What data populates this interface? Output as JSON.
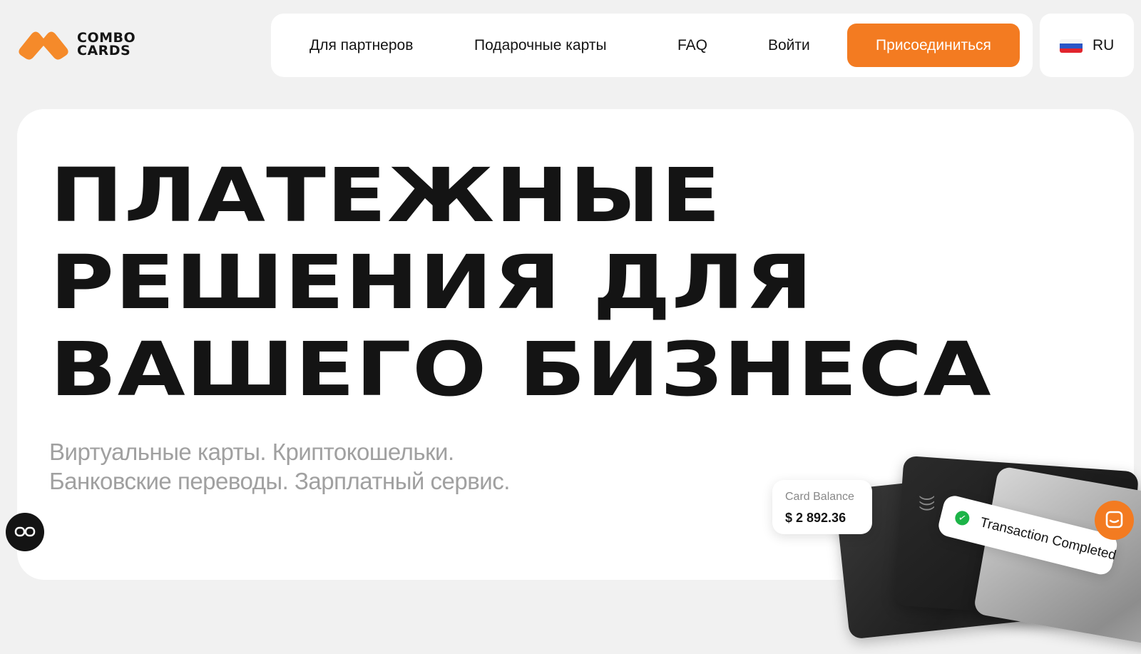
{
  "brand": {
    "logo_line1": "COMBO",
    "logo_line2": "CARDS",
    "accent": "#f37b21"
  },
  "nav": {
    "items": [
      {
        "label": "Для партнеров"
      },
      {
        "label": "Подарочные карты"
      },
      {
        "label": "FAQ"
      },
      {
        "label": "Войти"
      }
    ],
    "cta_label": "Присоединиться"
  },
  "language": {
    "code": "RU",
    "flag_icon": "russia-flag-icon"
  },
  "hero": {
    "title_lines": [
      "ПЛАТЕЖНЫЕ",
      "РЕШЕНИЯ ДЛЯ",
      "ВАШЕГО БИЗНЕСА"
    ],
    "subtitle_lines": [
      "Виртуальные карты. Криптокошельки.",
      "Банковские переводы. Зарплатный сервис."
    ]
  },
  "widgets": {
    "card_balance_label": "Card Balance",
    "card_balance_value": "$ 2 892.36",
    "transaction_text": "Transaction Completed",
    "check_icon": "check-circle-icon",
    "accessibility_icon": "accessibility-glasses-icon",
    "chat_icon": "chat-icon"
  }
}
